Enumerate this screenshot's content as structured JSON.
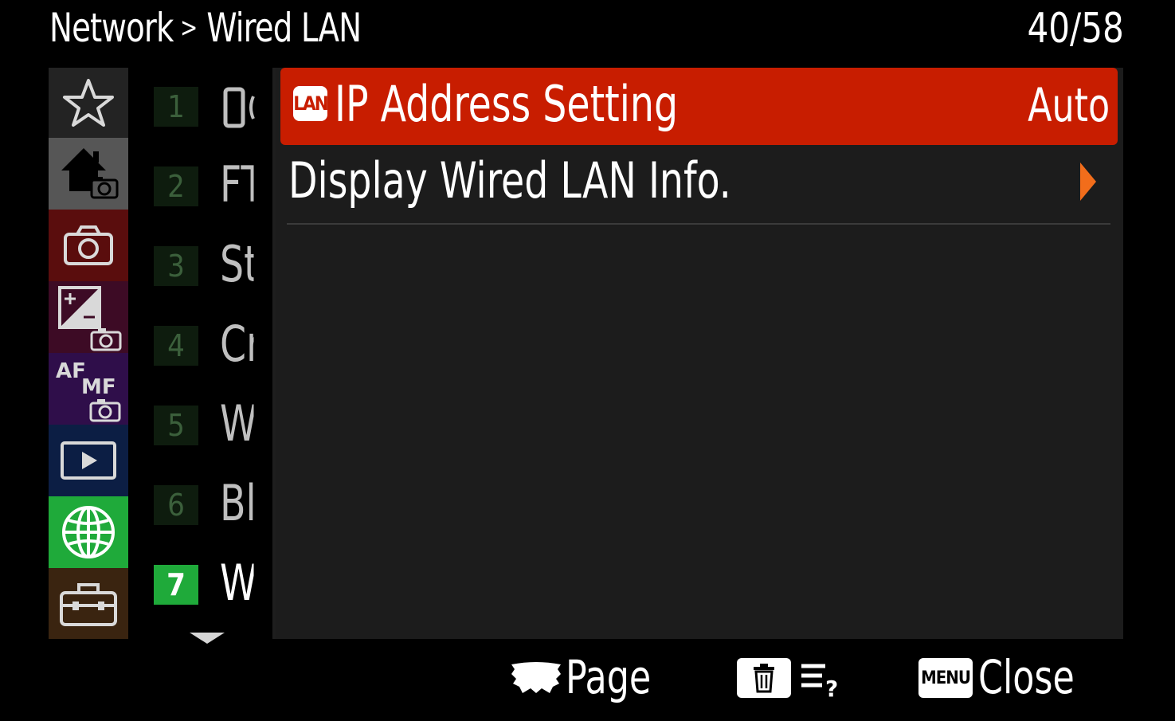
{
  "header": {
    "breadcrumb_parent": "Network",
    "breadcrumb_separator": ">",
    "breadcrumb_current": "Wired LAN",
    "page_counter": "40/58"
  },
  "categories": [
    {
      "icon": "star-icon",
      "name": "My Menu",
      "color": "#232323",
      "selected": false
    },
    {
      "icon": "home-camera-icon",
      "name": "Main",
      "color": "#565656",
      "selected": false
    },
    {
      "icon": "camera-icon",
      "name": "Shooting",
      "color": "#5a0d0d",
      "selected": false
    },
    {
      "icon": "exposure-color-icon",
      "name": "Exposure/Color",
      "color": "#3d0b25",
      "selected": false
    },
    {
      "icon": "af-mf-icon",
      "name": "Focus",
      "color": "#2f0e4a",
      "selected": false
    },
    {
      "icon": "playback-icon",
      "name": "Playback",
      "color": "#0c1e44",
      "selected": false
    },
    {
      "icon": "globe-icon",
      "name": "Network",
      "color": "#1faa3a",
      "selected": true
    },
    {
      "icon": "toolbox-icon",
      "name": "Setup",
      "color": "#3a2410",
      "selected": false
    }
  ],
  "sub_pages": [
    {
      "num": "1",
      "label": "",
      "glyph": "phone"
    },
    {
      "num": "2",
      "label": "FT"
    },
    {
      "num": "3",
      "label": "St"
    },
    {
      "num": "4",
      "label": "Cr"
    },
    {
      "num": "5",
      "label": "W"
    },
    {
      "num": "6",
      "label": "Bl"
    },
    {
      "num": "7",
      "label": "W",
      "active": true
    }
  ],
  "menu_items": [
    {
      "badge": "LAN",
      "label": "IP Address Setting",
      "value": "Auto",
      "selected": true
    },
    {
      "label": "Display Wired LAN Info.",
      "has_submenu": true
    }
  ],
  "footer": {
    "page_label": "Page",
    "menu_button": "MENU",
    "close_label": "Close"
  },
  "colors": {
    "selection_red": "#c81d00",
    "network_green": "#1faa3a",
    "submenu_arrow": "#f26d1b"
  }
}
